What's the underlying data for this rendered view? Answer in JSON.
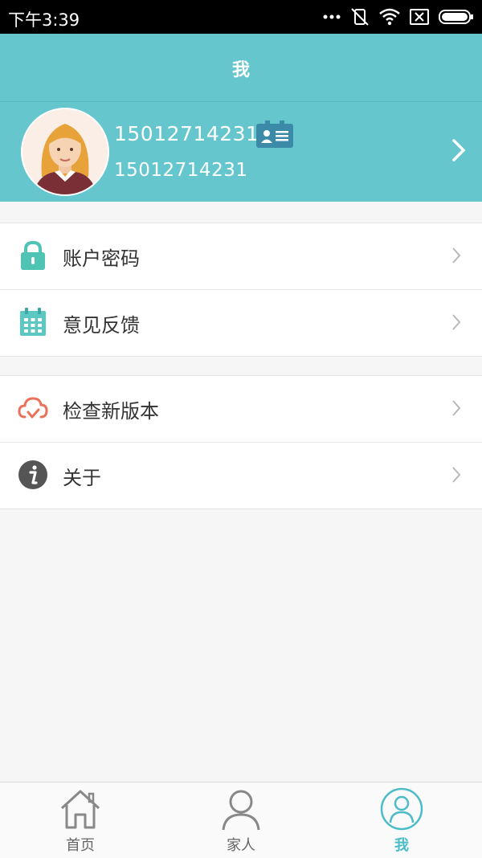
{
  "status_bar": {
    "time": "下午3:39",
    "battery_icon": "battery-icon",
    "wifi_icon": "wifi-icon",
    "mute_icon": "vibrate-off-icon"
  },
  "header": {
    "title": "我"
  },
  "profile": {
    "phone_primary": "15012714231",
    "phone_secondary": "15012714231",
    "id_icon": "id-card-icon"
  },
  "menu_group_1": [
    {
      "label": "账户密码",
      "icon": "lock-icon"
    },
    {
      "label": "意见反馈",
      "icon": "calendar-icon"
    }
  ],
  "menu_group_2": [
    {
      "label": "检查新版本",
      "icon": "cloud-check-icon"
    },
    {
      "label": "关于",
      "icon": "info-icon"
    }
  ],
  "tabs": [
    {
      "label": "首页",
      "icon": "home-icon"
    },
    {
      "label": "家人",
      "icon": "person-icon"
    },
    {
      "label": "我",
      "icon": "profile-icon",
      "active": true
    }
  ],
  "colors": {
    "accent": "#66c6ce",
    "tab_active": "#4bbcc8",
    "lock": "#4fc3b4",
    "cloud": "#e8735a",
    "info": "#555555"
  }
}
